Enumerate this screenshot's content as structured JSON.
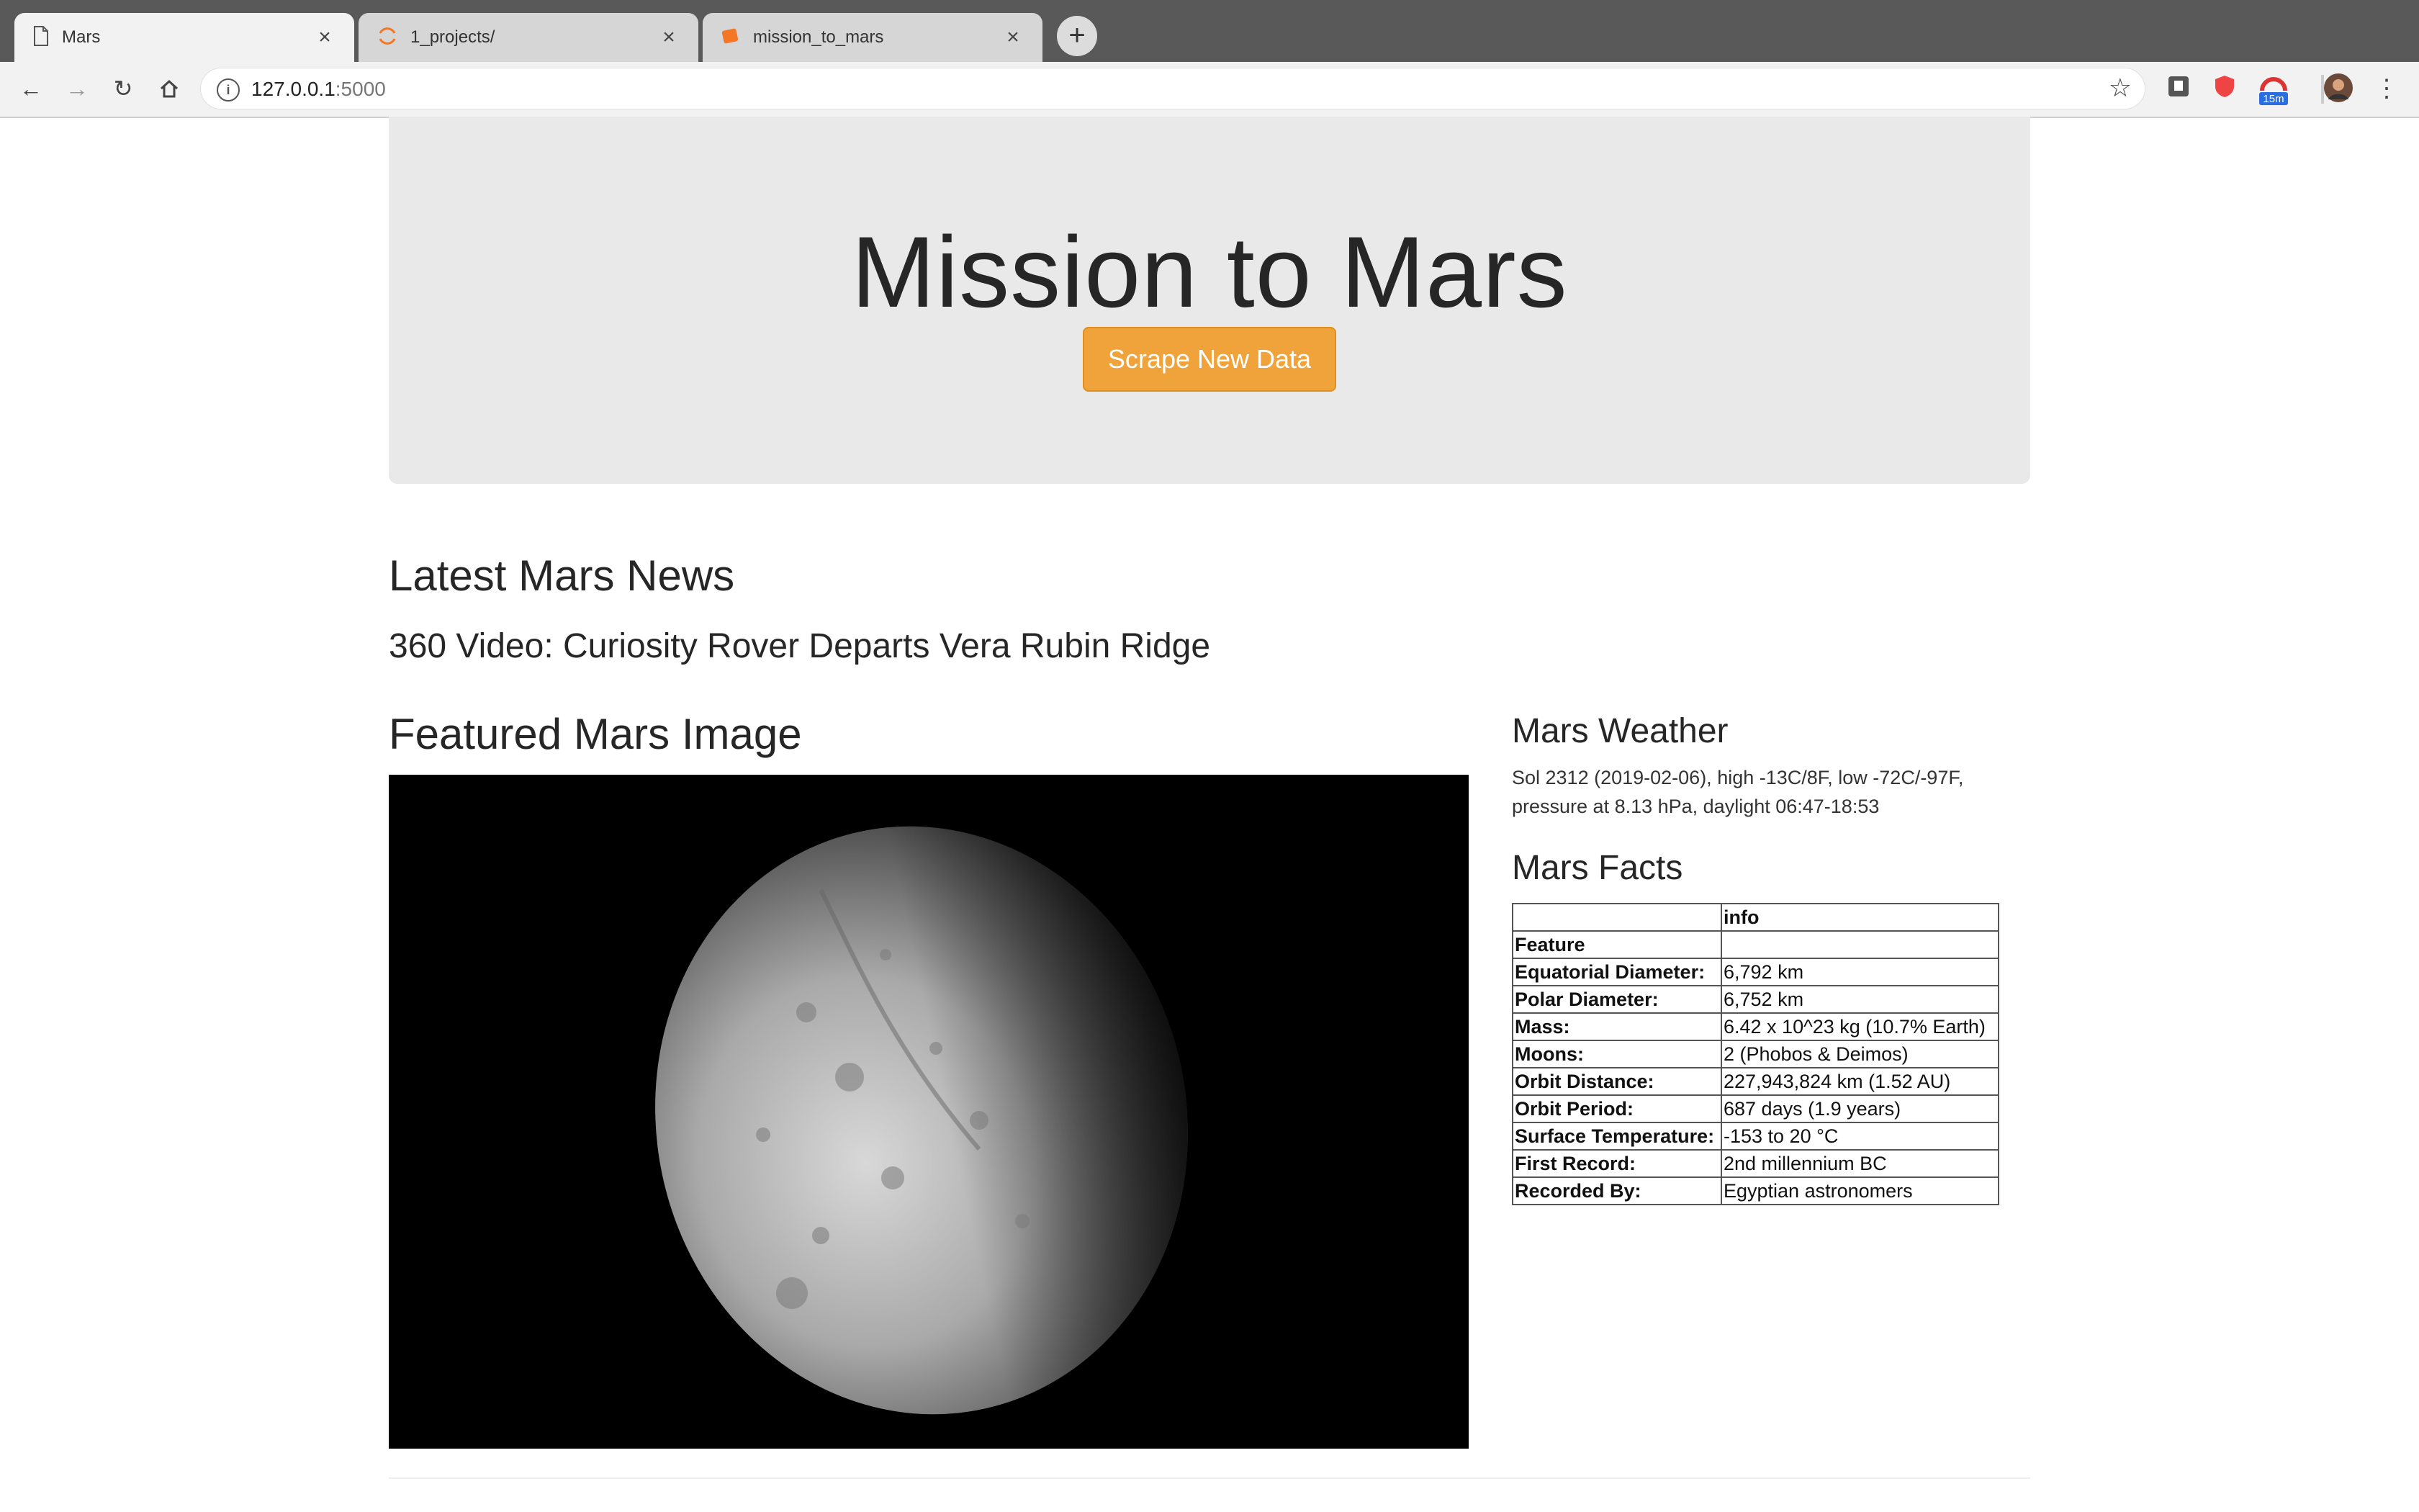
{
  "browser": {
    "tabs": [
      {
        "title": "Mars",
        "active": true,
        "icon": "page-icon"
      },
      {
        "title": "1_projects/",
        "active": false,
        "icon": "jupyter-icon"
      },
      {
        "title": "mission_to_mars",
        "active": false,
        "icon": "jupyter-notebook-icon"
      }
    ],
    "url_host": "127.0.0.1",
    "url_port": ":5000",
    "extension_badge": "15m"
  },
  "page": {
    "title": "Mission to Mars",
    "scrape_button": "Scrape New Data",
    "news_heading": "Latest Mars News",
    "news_title": "360 Video: Curiosity Rover Departs Vera Rubin Ridge",
    "image_heading": "Featured Mars Image",
    "weather_heading": "Mars Weather",
    "weather_text": "Sol 2312 (2019-02-06), high -13C/8F, low -72C/-97F, pressure at 8.13 hPa, daylight 06:47-18:53",
    "facts_heading": "Mars Facts",
    "facts": {
      "col_header": "info",
      "index_label": "Feature",
      "rows": [
        {
          "feature": "Equatorial Diameter:",
          "value": "6,792 km"
        },
        {
          "feature": "Polar Diameter:",
          "value": "6,752 km"
        },
        {
          "feature": "Mass:",
          "value": "6.42 x 10^23 kg (10.7% Earth)"
        },
        {
          "feature": "Moons:",
          "value": "2 (Phobos & Deimos)"
        },
        {
          "feature": "Orbit Distance:",
          "value": "227,943,824 km (1.52 AU)"
        },
        {
          "feature": "Orbit Period:",
          "value": "687 days (1.9 years)"
        },
        {
          "feature": "Surface Temperature:",
          "value": "-153 to 20 °C"
        },
        {
          "feature": "First Record:",
          "value": "2nd millennium BC"
        },
        {
          "feature": "Recorded By:",
          "value": "Egyptian astronomers"
        }
      ]
    }
  },
  "colors": {
    "accent_button": "#f0a33a",
    "jumbotron_bg": "#e9e9e9"
  }
}
